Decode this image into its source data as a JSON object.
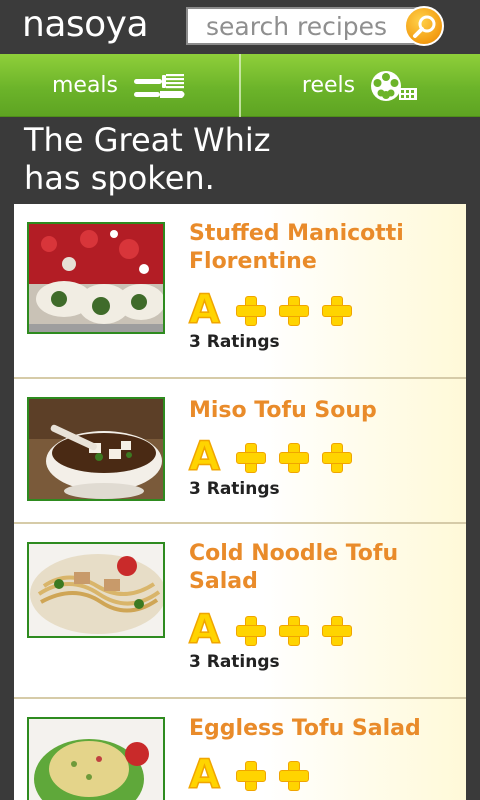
{
  "header": {
    "logo": "nasoya",
    "search": {
      "placeholder": "search recipes"
    }
  },
  "tabs": [
    {
      "label": "meals",
      "icon": "utensils-icon"
    },
    {
      "label": "reels",
      "icon": "film-reel-icon"
    }
  ],
  "heading": {
    "line1": "The Great Whiz",
    "line2": "has spoken."
  },
  "recipes": [
    {
      "name": "Stuffed Manicotti Florentine",
      "grade": "A",
      "plus_count": 3,
      "ratings": "3 Ratings",
      "image": "manicotti-photo"
    },
    {
      "name": "Miso Tofu Soup",
      "grade": "A",
      "plus_count": 3,
      "ratings": "3 Ratings",
      "image": "miso-soup-photo"
    },
    {
      "name": "Cold Noodle Tofu Salad",
      "grade": "A",
      "plus_count": 3,
      "ratings": "3 Ratings",
      "image": "noodle-salad-photo"
    },
    {
      "name": "Eggless Tofu Salad",
      "grade": "A",
      "plus_count": 2,
      "ratings": "",
      "image": "eggless-salad-photo"
    }
  ],
  "colors": {
    "accent_green": "#6cb42a",
    "recipe_title": "#e98b2a",
    "grade_yellow": "#ffd400",
    "background": "#3a3a3a"
  }
}
